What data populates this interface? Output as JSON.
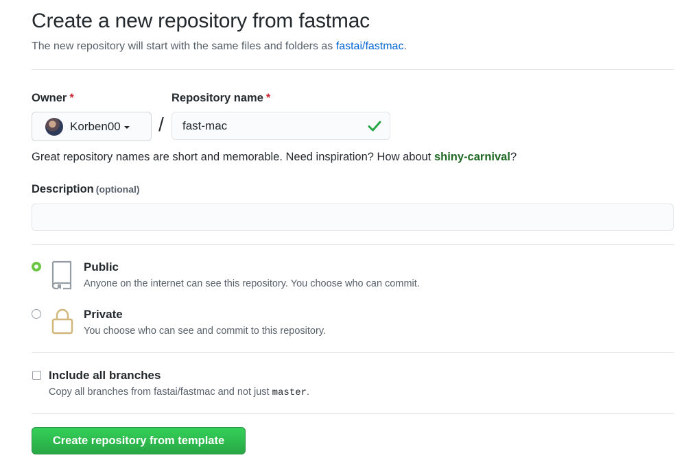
{
  "header": {
    "title": "Create a new repository from fastmac",
    "subtitle_prefix": "The new repository will start with the same files and folders as ",
    "template_link": "fastai/fastmac",
    "subtitle_suffix": "."
  },
  "owner": {
    "label": "Owner",
    "required_mark": "*",
    "value": "Korben00"
  },
  "separator": "/",
  "repo_name": {
    "label": "Repository name",
    "required_mark": "*",
    "value": "fast-mac",
    "valid": true
  },
  "name_hint": {
    "prefix": "Great repository names are short and memorable. Need inspiration? How about ",
    "suggestion": "shiny-carnival",
    "suffix": "?"
  },
  "description": {
    "label": "Description",
    "optional": "(optional)",
    "value": ""
  },
  "visibility": {
    "selected": "public",
    "options": [
      {
        "id": "public",
        "title": "Public",
        "description": "Anyone on the internet can see this repository. You choose who can commit.",
        "icon": "repo-book-icon"
      },
      {
        "id": "private",
        "title": "Private",
        "description": "You choose who can see and commit to this repository.",
        "icon": "lock-icon"
      }
    ]
  },
  "include_branches": {
    "label": "Include all branches",
    "checked": false,
    "description_prefix": "Copy all branches from fastai/fastmac and not just ",
    "branch": "master",
    "description_suffix": "."
  },
  "submit": {
    "label": "Create repository from template"
  },
  "colors": {
    "link": "#0366d6",
    "required": "#cb2431",
    "suggestion": "#1e6823",
    "primary_button": "#28a745",
    "radio_selected": "#6cc644",
    "valid_check": "#28a745"
  }
}
